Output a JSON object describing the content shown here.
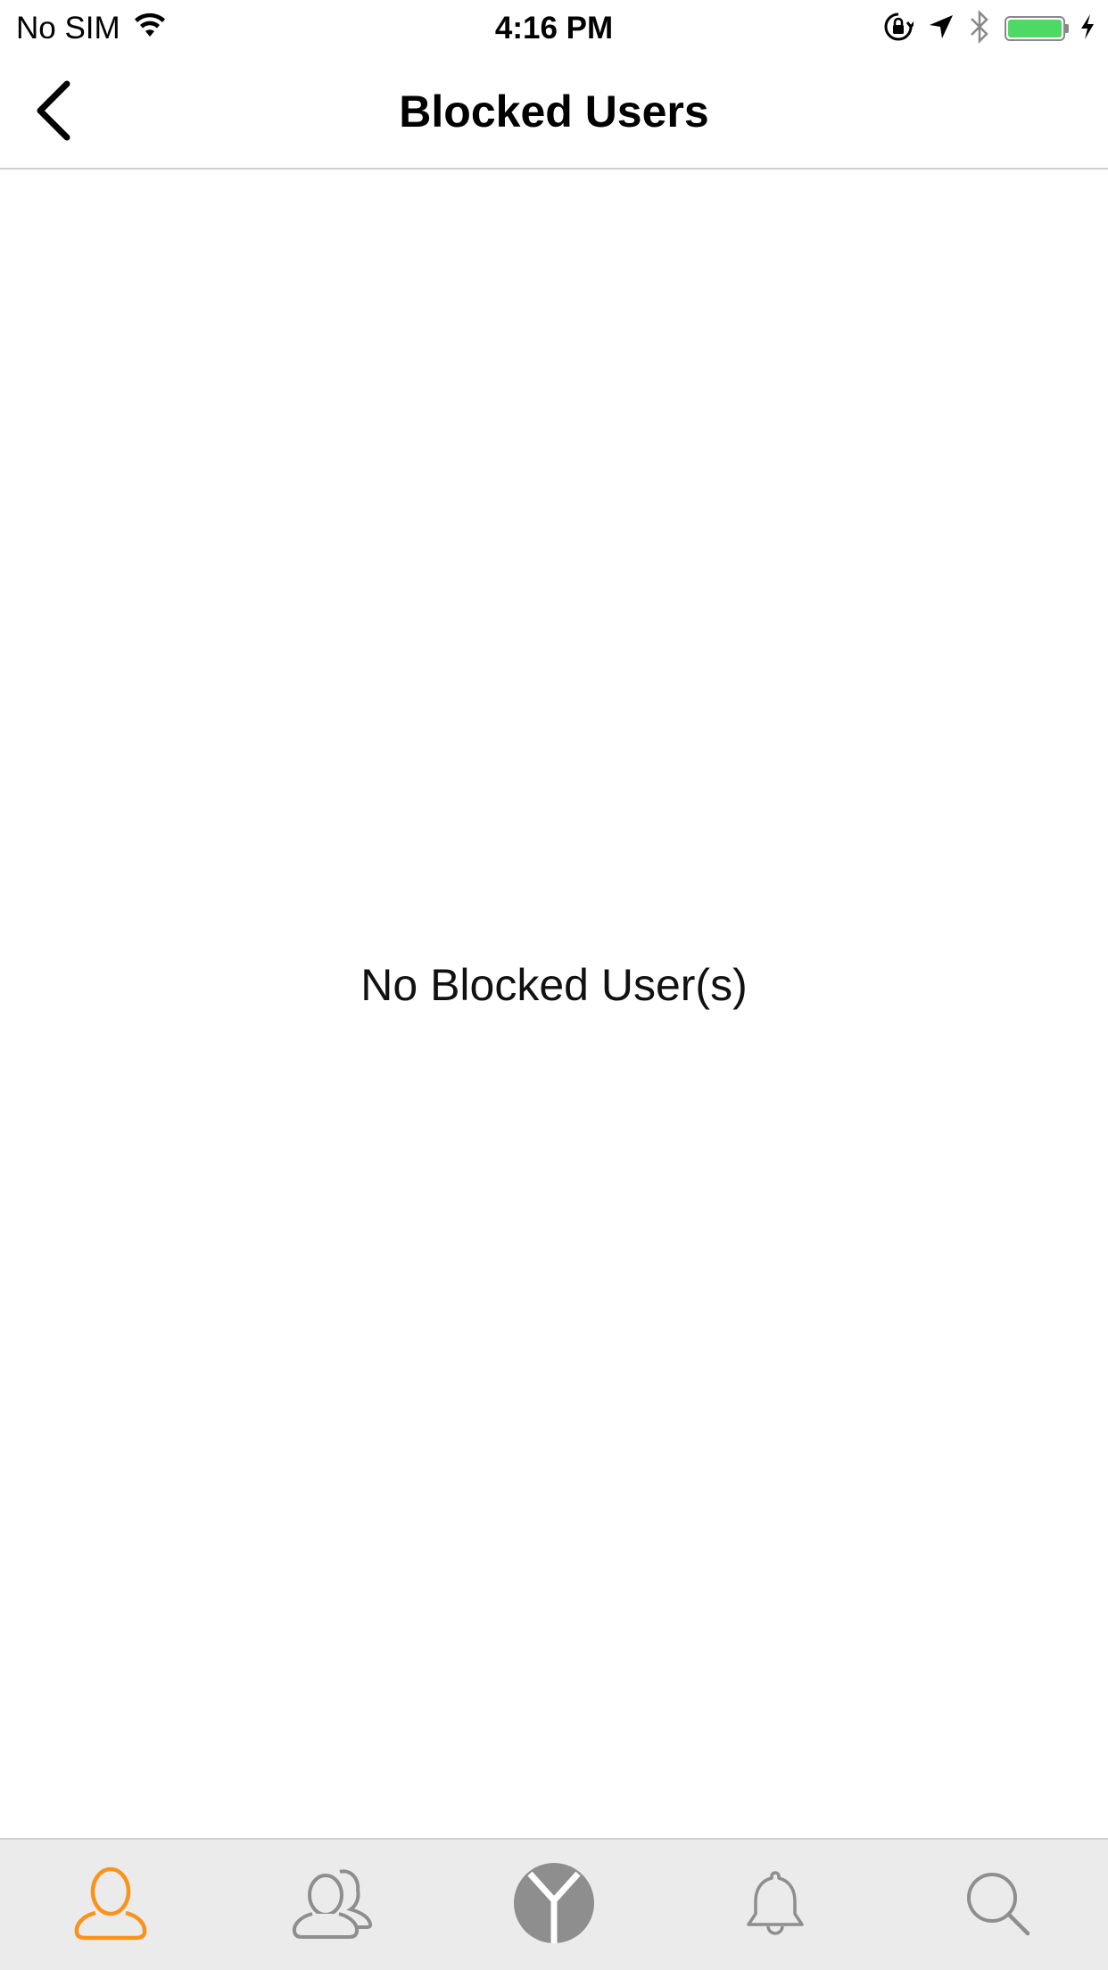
{
  "status_bar": {
    "carrier": "No SIM",
    "time": "4:16 PM",
    "battery_color": "#4cd964"
  },
  "nav": {
    "title": "Blocked Users",
    "back_icon": "chevron-left-icon"
  },
  "main": {
    "empty_message": "No Blocked User(s)"
  },
  "tab_bar": {
    "active_color": "#f7941d",
    "inactive_color": "#8e8e8e",
    "items": [
      {
        "icon": "profile-icon",
        "active": true
      },
      {
        "icon": "friends-icon",
        "active": false
      },
      {
        "icon": "app-logo-icon",
        "active": false
      },
      {
        "icon": "bell-icon",
        "active": false
      },
      {
        "icon": "search-icon",
        "active": false
      }
    ]
  }
}
